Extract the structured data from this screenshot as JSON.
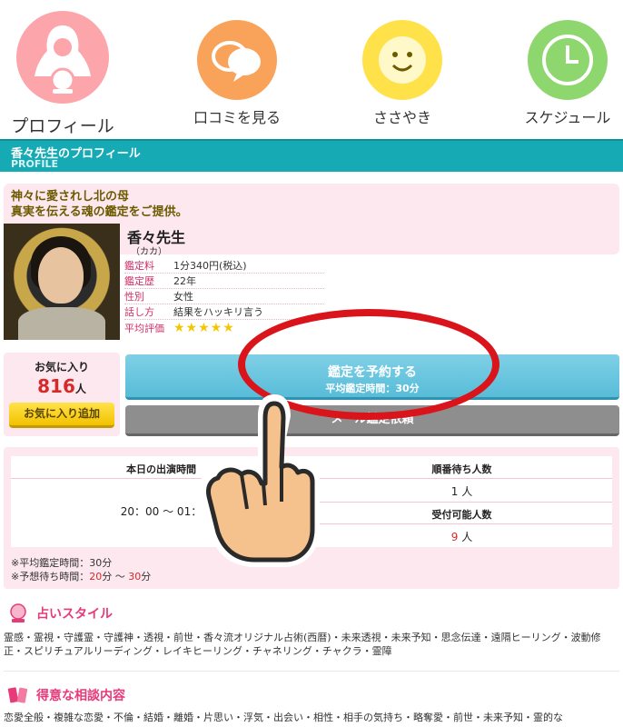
{
  "nav": {
    "profile": "プロフィール",
    "reviews": "口コミを見る",
    "whisper": "ささやき",
    "schedule": "スケジュール"
  },
  "header": {
    "title": "香々先生のプロフィール",
    "subtitle": "PROFILE"
  },
  "profile": {
    "tagline1": "神々に愛されし北の母",
    "tagline2": "真実を伝える魂の鑑定をご提供。",
    "name": "香々先生",
    "kana": "（カカ）",
    "specs": [
      {
        "key": "鑑定料",
        "value": "1分340円(税込)"
      },
      {
        "key": "鑑定歴",
        "value": "22年"
      },
      {
        "key": "性別",
        "value": "女性"
      },
      {
        "key": "話し方",
        "value": "結果をハッキリ言う"
      },
      {
        "key": "平均評価",
        "value": "★★★★★"
      }
    ],
    "rating_stars": 5
  },
  "favorites": {
    "label": "お気に入り",
    "count": "816",
    "unit": "人",
    "add_label": "お気に入り追加"
  },
  "buttons": {
    "reserve_label": "鑑定を予約する",
    "reserve_sub": "平均鑑定時間：30分",
    "mail_label": "メール鑑定依頼"
  },
  "schedule": {
    "today_label": "本日の出演時間",
    "today_value": "20：00 〜 01：",
    "queue_label": "順番待ち人数",
    "queue_value": "1 人",
    "accept_label": "受付可能人数",
    "accept_value": "9",
    "accept_unit": " 人",
    "note1": "※平均鑑定時間：30分",
    "note2_prefix": "※予想待ち時間：",
    "note2_a": "20",
    "note2_mid": "分 〜 ",
    "note2_b": "30",
    "note2_suffix": "分"
  },
  "style_section": {
    "title": "占いスタイル",
    "text": "霊感・霊視・守護霊・守護神・透視・前世・香々流オリジナル占術(西暦)・未来透視・未来予知・思念伝達・遠隔ヒーリング・波動修正・スピリチュアルリーディング・レイキヒーリング・チャネリング・チャクラ・霊障"
  },
  "topics_section": {
    "title": "得意な相談内容",
    "text": "恋愛全般・複雑な恋愛・不倫・結婚・離婚・片思い・浮気・出会い・相性・相手の気持ち・略奪愛・前世・未来予知・霊的な"
  },
  "colors": {
    "accent_pink": "#e63a7a",
    "header_teal": "#15aab4",
    "circle_red": "#d9141b"
  }
}
